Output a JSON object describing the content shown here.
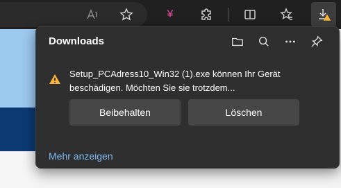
{
  "toolbar": {
    "icons": [
      "read-aloud-icon",
      "favorite-star-icon",
      "yen-icon",
      "extensions-icon",
      "split-screen-icon",
      "favorites-icon",
      "downloads-icon"
    ],
    "yen_glyph": "¥",
    "accent": "#e5479c"
  },
  "downloads": {
    "title": "Downloads",
    "header_icons": [
      "open-folder-icon",
      "search-icon",
      "more-options-icon",
      "pin-icon"
    ],
    "warning": {
      "message": "Setup_PCAdress10_Win32 (1).exe können Ihr Gerät beschädigen. Möchten Sie sie trotzdem...",
      "icon_color": "#f8b436"
    },
    "buttons": {
      "keep": "Beibehalten",
      "delete": "Löschen"
    },
    "more_link": "Mehr anzeigen",
    "link_color": "#7db8f0"
  }
}
